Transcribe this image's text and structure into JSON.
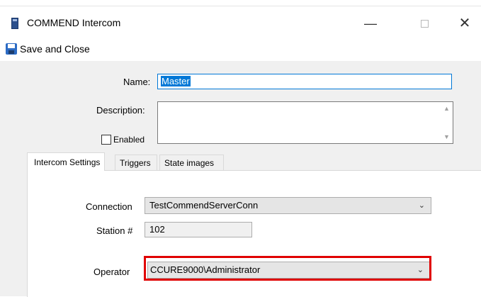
{
  "window": {
    "title": "COMMEND Intercom",
    "minimize_glyph": "—",
    "close_glyph": "✕"
  },
  "toolbar": {
    "save_close_label": "Save and Close"
  },
  "form": {
    "name_label": "Name:",
    "name_value": "Master",
    "description_label": "Description:",
    "description_value": "",
    "enabled_label": "Enabled",
    "enabled_checked": false
  },
  "tabs": [
    {
      "label": "Intercom Settings",
      "active": true
    },
    {
      "label": "Triggers",
      "active": false
    },
    {
      "label": "State images",
      "active": false
    }
  ],
  "intercom_settings": {
    "connection_label": "Connection",
    "connection_value": "TestCommendServerConn",
    "station_label": "Station #",
    "station_value": "102",
    "operator_label": "Operator",
    "operator_value": "CCURE9000\\Administrator"
  },
  "icons": {
    "app": "intercom-app-icon",
    "save": "floppy-disk-icon",
    "dropdown": "chevron-down-icon"
  },
  "colors": {
    "accent": "#0078d7",
    "highlight": "#e00000"
  }
}
